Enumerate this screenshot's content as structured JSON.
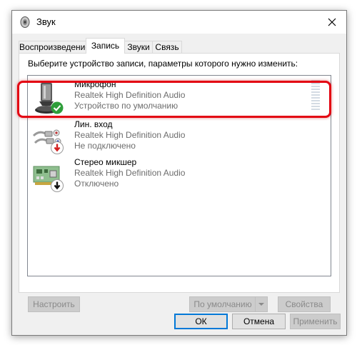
{
  "window": {
    "title": "Звук"
  },
  "tabs": [
    {
      "label": "Воспроизведение",
      "active": false
    },
    {
      "label": "Запись",
      "active": true
    },
    {
      "label": "Звуки",
      "active": false
    },
    {
      "label": "Связь",
      "active": false
    }
  ],
  "panel": {
    "instruction": "Выберите устройство записи, параметры которого нужно изменить:"
  },
  "devices": [
    {
      "name": "Микрофон",
      "driver": "Realtek High Definition Audio",
      "status": "Устройство по умолчанию",
      "icon": "microphone-icon",
      "badge": "default-check-badge-icon",
      "selected": true
    },
    {
      "name": "Лин. вход",
      "driver": "Realtek High Definition Audio",
      "status": "Не подключено",
      "icon": "line-in-jack-icon",
      "badge": "not-connected-arrow-icon",
      "selected": false
    },
    {
      "name": "Стерео микшер",
      "driver": "Realtek High Definition Audio",
      "status": "Отключено",
      "icon": "sound-card-icon",
      "badge": "disabled-arrow-icon",
      "selected": false
    }
  ],
  "panel_buttons": {
    "configure": "Настроить",
    "set_default": "По умолчанию",
    "properties": "Свойства"
  },
  "dialog_buttons": {
    "ok": "ОК",
    "cancel": "Отмена",
    "apply": "Применить"
  },
  "colors": {
    "highlight": "#e30613",
    "check_green": "#2e9e3a",
    "arrow_red": "#d21f1f",
    "focus_blue": "#0078d7"
  }
}
